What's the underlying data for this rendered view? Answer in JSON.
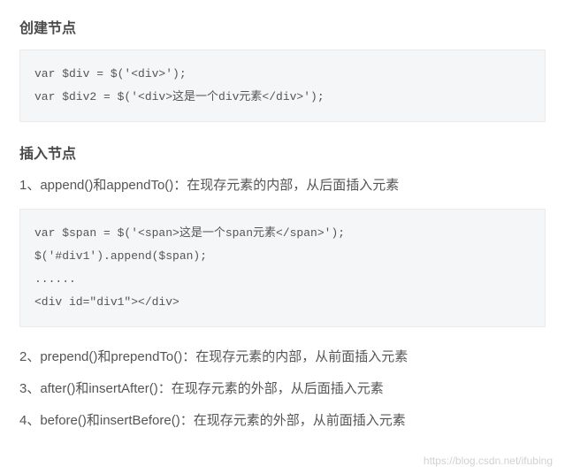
{
  "section1": {
    "heading": "创建节点",
    "code": "var $div = $('<div>');\nvar $div2 = $('<div>这是一个div元素</div>');"
  },
  "section2": {
    "heading": "插入节点",
    "intro": "1、append()和appendTo()：在现存元素的内部，从后面插入元素",
    "code": "var $span = $('<span>这是一个span元素</span>');\n$('#div1').append($span);\n......\n<div id=\"div1\"></div>",
    "items": [
      "2、prepend()和prependTo()：在现存元素的内部，从前面插入元素",
      "3、after()和insertAfter()：在现存元素的外部，从后面插入元素",
      "4、before()和insertBefore()：在现存元素的外部，从前面插入元素"
    ]
  },
  "watermark": "https://blog.csdn.net/ifubing"
}
